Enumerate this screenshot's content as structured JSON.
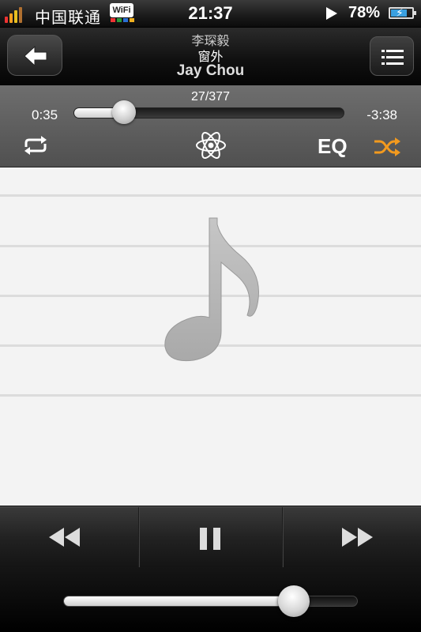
{
  "status_bar": {
    "carrier": "中国联通",
    "wifi_label": "WiFi",
    "time": "21:37",
    "battery_percent": "78%",
    "battery_level": 0.78
  },
  "header": {
    "artist_cn": "李琛毅",
    "title": "窗外",
    "artist": "Jay Chou"
  },
  "playback": {
    "track_count": "27/377",
    "elapsed": "0:35",
    "remaining": "-3:38",
    "progress": 0.17,
    "eq_label": "EQ"
  },
  "volume": {
    "level": 0.8
  },
  "colors": {
    "shuffle_active": "#f39a1e",
    "artwork_bg": "#f3f3f3",
    "note": "#b4b4b4"
  },
  "icons": {
    "back": "left-arrow-icon",
    "menu": "list-icon",
    "repeat": "repeat-icon",
    "visualizer": "atom-icon",
    "shuffle": "shuffle-icon",
    "artwork": "music-note-icon",
    "rewind": "rewind-icon",
    "pause": "pause-icon",
    "forward": "fast-forward-icon"
  }
}
